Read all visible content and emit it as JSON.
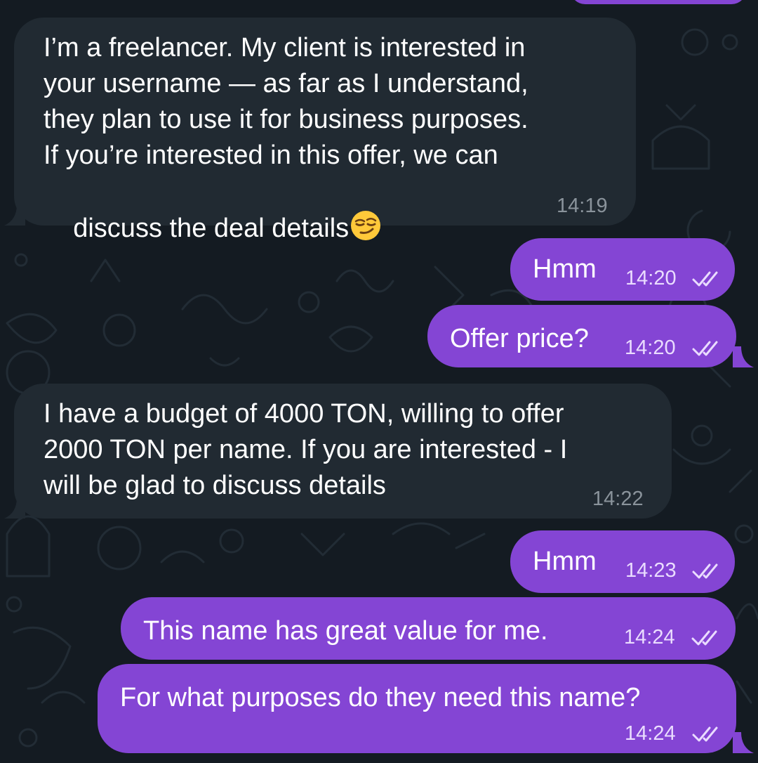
{
  "theme": {
    "background": "#141b22",
    "incoming_bubble": "#212a32",
    "outgoing_bubble": "#8445d4",
    "incoming_time_color": "#8a939b",
    "outgoing_time_color": "#eadcff"
  },
  "messages": [
    {
      "direction": "incoming",
      "lines": [
        "I’m a freelancer. My client is interested in",
        "your username — as far as I understand,",
        "they plan to use it for business purposes.",
        "If you’re interested in this offer, we can",
        "discuss the deal details"
      ],
      "emoji": "smirking-face",
      "time": "14:19"
    },
    {
      "direction": "outgoing",
      "text": "Hmm",
      "time": "14:20",
      "status": "read"
    },
    {
      "direction": "outgoing",
      "text": "Offer price?",
      "time": "14:20",
      "status": "read"
    },
    {
      "direction": "incoming",
      "lines": [
        "I have a budget of 4000 TON, willing to offer",
        "2000 TON per name. If you are interested - I",
        "will be glad to discuss details"
      ],
      "time": "14:22"
    },
    {
      "direction": "outgoing",
      "text": "Hmm",
      "time": "14:23",
      "status": "read"
    },
    {
      "direction": "outgoing",
      "text": "This name has great value for me.",
      "time": "14:24",
      "status": "read"
    },
    {
      "direction": "outgoing",
      "text": "For what purposes do they need this name?",
      "time": "14:24",
      "status": "read"
    }
  ]
}
